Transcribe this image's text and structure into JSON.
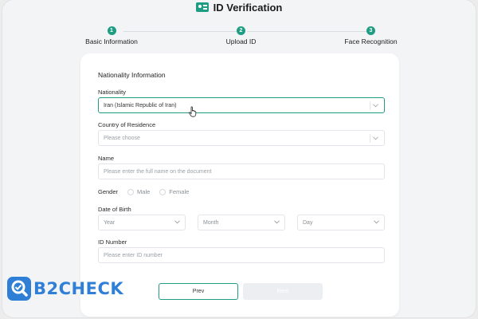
{
  "header": {
    "title": "ID Verification",
    "icon": "id-card-icon"
  },
  "steps": [
    {
      "number": "1",
      "label": "Basic Information"
    },
    {
      "number": "2",
      "label": "Upload ID"
    },
    {
      "number": "3",
      "label": "Face Recognition"
    }
  ],
  "form": {
    "section_title": "Nationality Information",
    "nationality": {
      "label": "Nationality",
      "value": "Iran (Islamic Republic of Iran)"
    },
    "residence": {
      "label": "Country of Residence",
      "placeholder": "Please choose"
    },
    "name": {
      "label": "Name",
      "placeholder": "Please enter the full name on the document"
    },
    "gender": {
      "label": "Gender",
      "options": [
        "Male",
        "Female"
      ]
    },
    "dob": {
      "label": "Date of Birth",
      "year": "Year",
      "month": "Month",
      "day": "Day"
    },
    "id_number": {
      "label": "ID Number",
      "placeholder": "Please enter ID number"
    }
  },
  "buttons": {
    "prev": "Prev",
    "next": "Next"
  },
  "watermark": {
    "text": "B2CHECK"
  },
  "colors": {
    "accent": "#1f9d83",
    "brand": "#2f7fd6"
  }
}
